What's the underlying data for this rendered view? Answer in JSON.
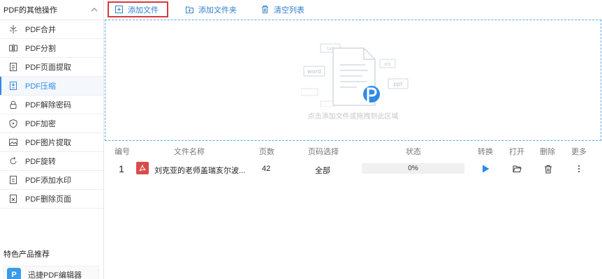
{
  "sidebar": {
    "header": "PDF的其他操作",
    "items": [
      {
        "label": "PDF合并",
        "icon": "merge-icon"
      },
      {
        "label": "PDF分割",
        "icon": "split-icon"
      },
      {
        "label": "PDF页面提取",
        "icon": "extract-page-icon"
      },
      {
        "label": "PDF压缩",
        "icon": "compress-icon",
        "active": true
      },
      {
        "label": "PDF解除密码",
        "icon": "unlock-icon"
      },
      {
        "label": "PDF加密",
        "icon": "shield-icon"
      },
      {
        "label": "PDF图片提取",
        "icon": "image-icon"
      },
      {
        "label": "PDF旋转",
        "icon": "rotate-icon"
      },
      {
        "label": "PDF添加水印",
        "icon": "watermark-icon"
      },
      {
        "label": "PDF删除页面",
        "icon": "delete-page-icon"
      }
    ],
    "featured_title": "特色产品推荐",
    "featured_item": "迅捷PDF编辑器"
  },
  "toolbar": {
    "add_file": "添加文件",
    "add_folder": "添加文件夹",
    "clear_list": "清空列表"
  },
  "dropzone": {
    "hint": "点击添加文件或拖拽到此区域",
    "tags": [
      "txt",
      "word",
      "xls",
      "ppt"
    ]
  },
  "table": {
    "headers": [
      "编号",
      "文件名称",
      "页数",
      "页码选择",
      "状态",
      "转换",
      "打开",
      "删除",
      "更多"
    ],
    "rows": [
      {
        "index": "1",
        "name": "刘克亚的老师盖瑞亥尔波...",
        "pages": "42",
        "page_select": "全部",
        "progress": "0%"
      }
    ]
  },
  "colors": {
    "accent": "#2f8ae5",
    "highlight_border": "#d83a3a",
    "pdf_red": "#d94b4b"
  }
}
